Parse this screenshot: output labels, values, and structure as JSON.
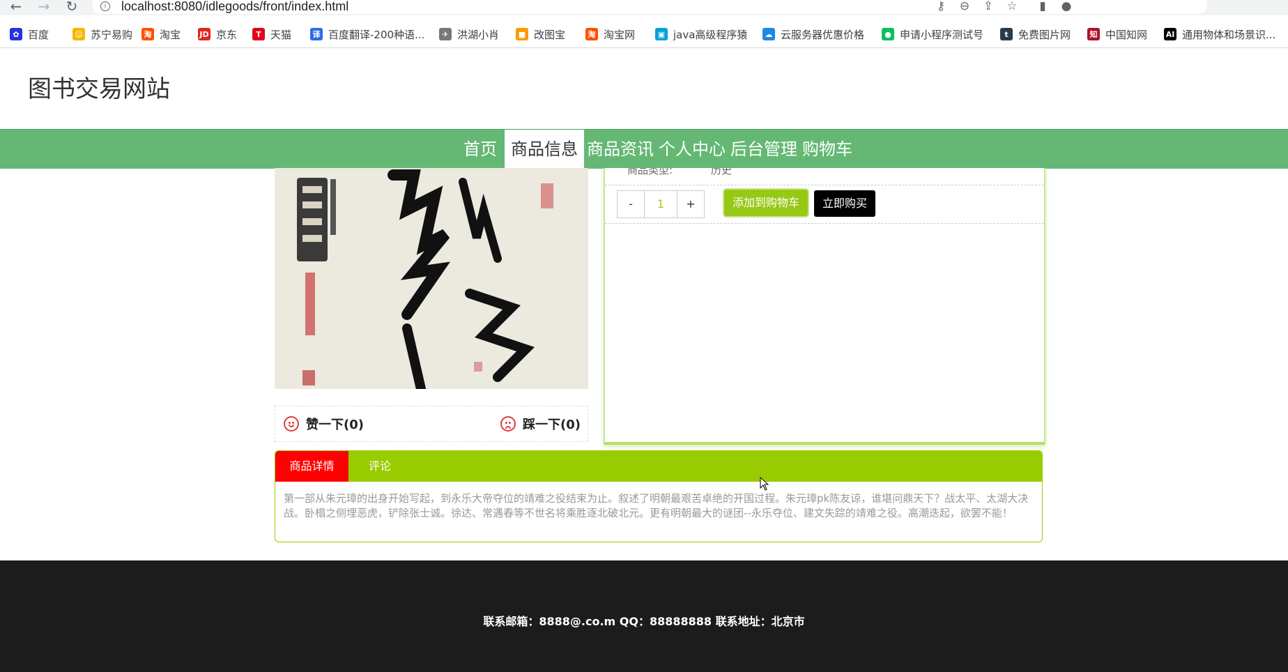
{
  "browser": {
    "url": "localhost:8080/idlegoods/front/index.html",
    "bookmarks": [
      {
        "label": "百度",
        "icon": "baidu-paw-icon",
        "color": "#2932e1"
      },
      {
        "label": "苏宁易购",
        "icon": "suning-lion-icon",
        "color": "#f5b800"
      },
      {
        "label": "淘宝",
        "icon": "taobao-icon",
        "color": "#ff5000"
      },
      {
        "label": "京东",
        "icon": "jd-icon",
        "color": "#e1251b"
      },
      {
        "label": "天猫",
        "icon": "tmall-icon",
        "color": "#e1001a"
      },
      {
        "label": "百度翻译-200种语...",
        "icon": "baidu-translate-icon",
        "color": "#2e6be6"
      },
      {
        "label": "洪湖小肖",
        "icon": "bird-icon",
        "color": "#777777"
      },
      {
        "label": "改图宝",
        "icon": "gaitubao-icon",
        "color": "#ff9900"
      },
      {
        "label": "淘宝网",
        "icon": "taobao-icon",
        "color": "#ff5000"
      },
      {
        "label": "java高级程序猿",
        "icon": "bilibili-tv-icon",
        "color": "#00a1d6"
      },
      {
        "label": "云服务器优惠价格",
        "icon": "cloud-icon",
        "color": "#1e88e5"
      },
      {
        "label": "申请小程序测试号",
        "icon": "wechat-icon",
        "color": "#07c160"
      },
      {
        "label": "免费图片网",
        "icon": "t-circle-icon",
        "color": "#2b3a4a"
      },
      {
        "label": "中国知网",
        "icon": "cnki-icon",
        "color": "#b0102a"
      },
      {
        "label": "通用物体和场景识...",
        "icon": "ai-icon",
        "color": "#000000"
      }
    ]
  },
  "site": {
    "title": "图书交易网站",
    "nav": [
      {
        "label": "首页",
        "active": false
      },
      {
        "label": "商品信息",
        "active": true
      },
      {
        "label": "商品资讯",
        "active": false
      },
      {
        "label": "个人中心",
        "active": false
      },
      {
        "label": "后台管理",
        "active": false
      },
      {
        "label": "购物车",
        "active": false
      }
    ],
    "nav_color": "#64b874"
  },
  "product": {
    "type_label": "商品类型:",
    "type_value": "历史",
    "quantity": "1",
    "minus_label": "-",
    "plus_label": "+",
    "add_to_cart_label": "添加到购物车",
    "buy_now_label": "立即购买",
    "like_label": "赞一下(0)",
    "dislike_label": "踩一下(0)",
    "accent_color": "#99cc00"
  },
  "tabs": {
    "items": [
      {
        "label": "商品详情",
        "active": true
      },
      {
        "label": "评论",
        "active": false
      }
    ],
    "detail_text": "第一部从朱元璋的出身开始写起，到永乐大帝夺位的靖难之役结束为止。叙述了明朝最艰苦卓绝的开国过程。朱元璋pk陈友谅，谁堪问鼎天下？战太平、太湖大决战。卧榻之侧埋恶虎，铲除张士诚。徐达、常遇春等不世名将乘胜逐北破北元。更有明朝最大的谜团--永乐夺位、建文失踪的靖难之役。高潮迭起，欲罢不能！"
  },
  "footer": {
    "contact": "联系邮箱：8888@.co.m QQ：88888888 联系地址：北京市"
  }
}
